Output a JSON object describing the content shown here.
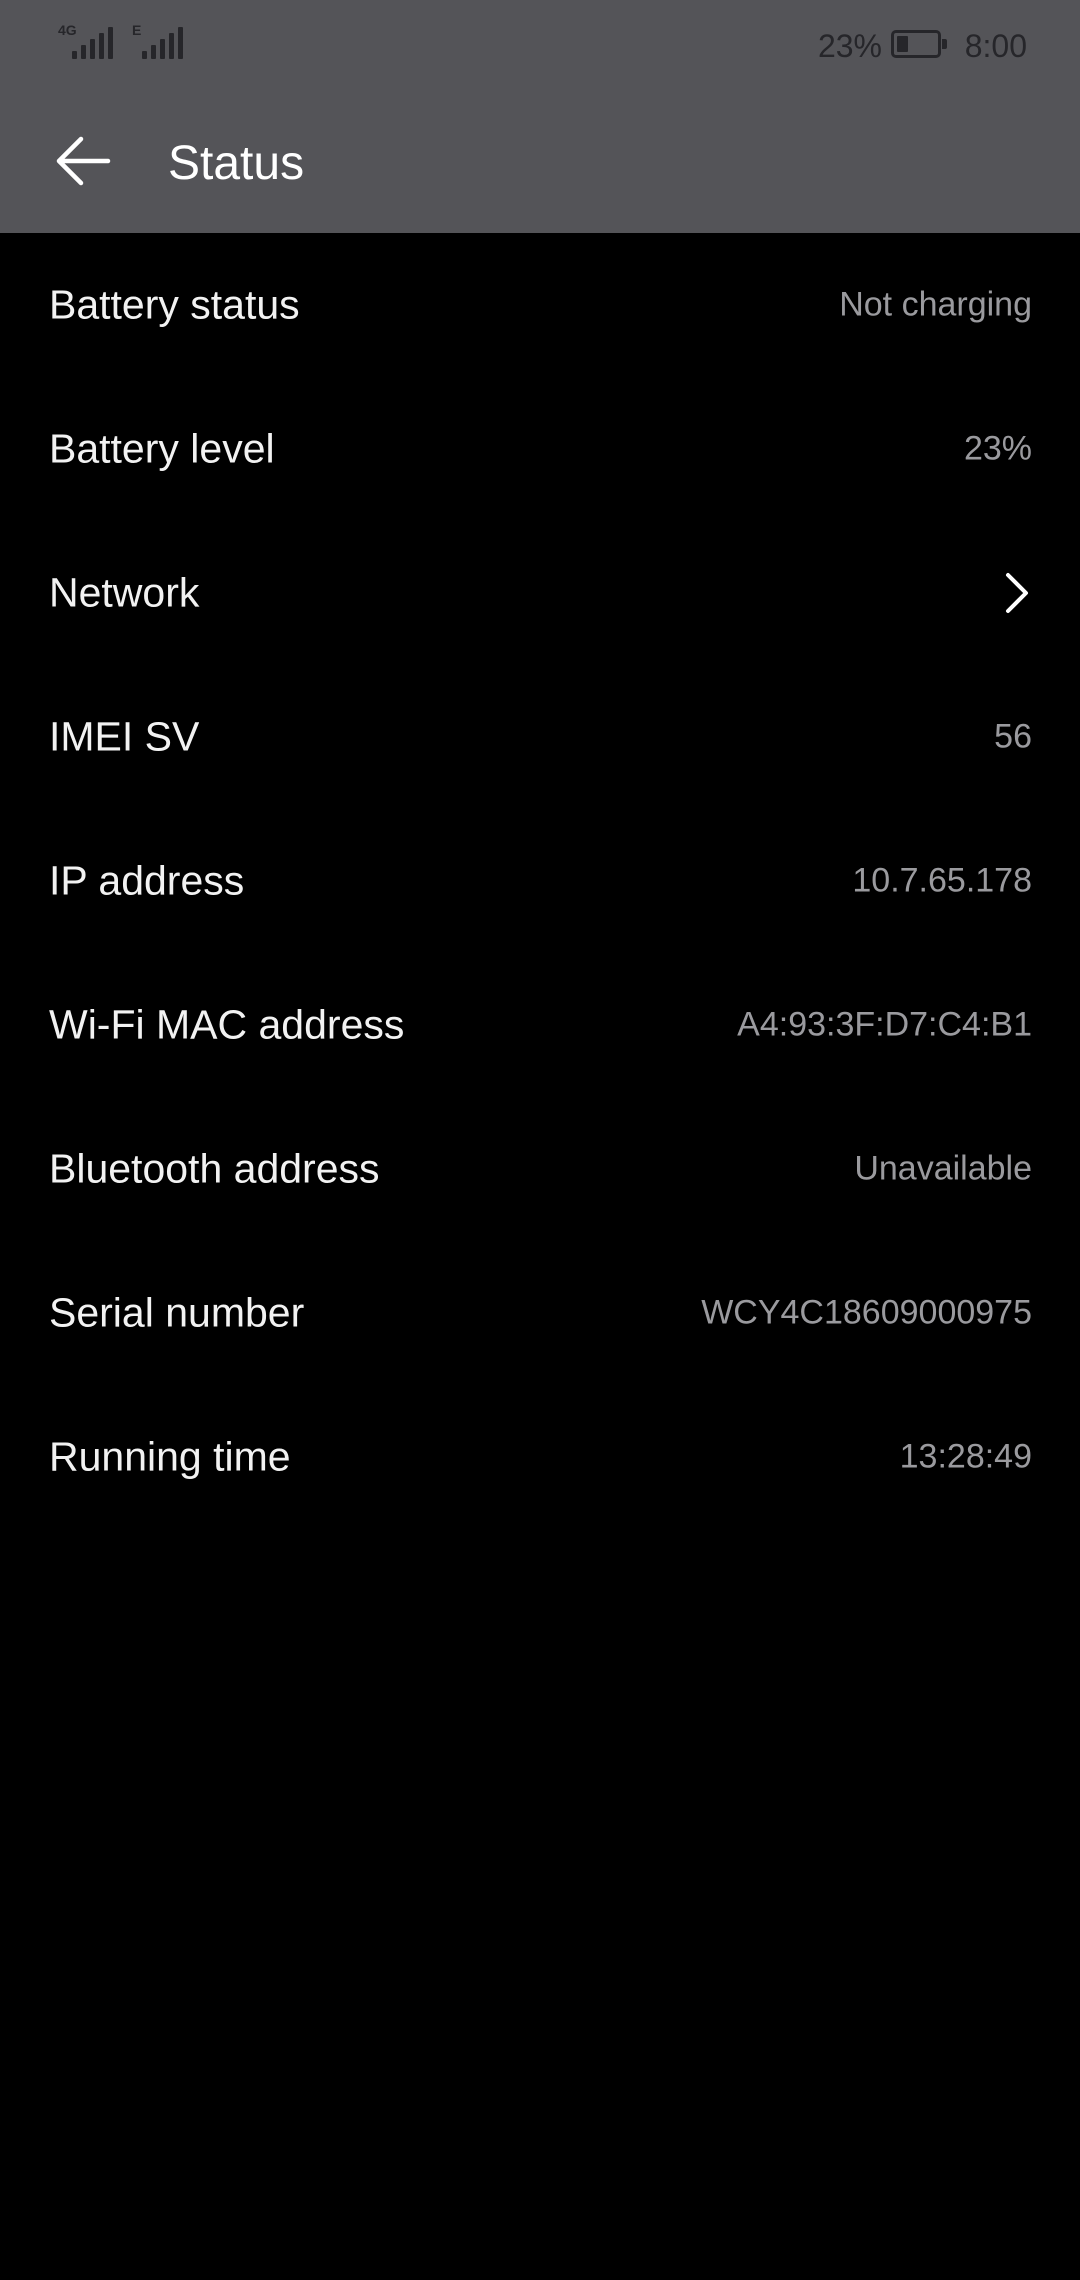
{
  "status_bar": {
    "signal_1_label": "4G",
    "signal_2_label": "E",
    "battery_percent": "23%",
    "battery_level_fraction": 0.23,
    "time": "8:00"
  },
  "title_bar": {
    "back_icon": "arrow-left-icon",
    "title": "Status"
  },
  "rows": [
    {
      "label": "Battery status",
      "value": "Not charging"
    },
    {
      "label": "Battery level",
      "value": "23%"
    },
    {
      "label": "Network",
      "value": "",
      "icon": "chevron-right-icon"
    },
    {
      "label": "IMEI SV",
      "value": "56"
    },
    {
      "label": "IP address",
      "value": "10.7.65.178"
    },
    {
      "label": "Wi-Fi MAC address",
      "value": "A4:93:3F:D7:C4:B1"
    },
    {
      "label": "Bluetooth address",
      "value": "Unavailable"
    },
    {
      "label": "Serial number",
      "value": "WCY4C18609000975"
    },
    {
      "label": "Running time",
      "value": "13:28:49"
    }
  ],
  "colors": {
    "header_bg": "#545458",
    "page_bg": "#000000",
    "label_text": "#f2f2f2",
    "value_text": "#9a9a9e",
    "status_icons": "#26262a"
  }
}
